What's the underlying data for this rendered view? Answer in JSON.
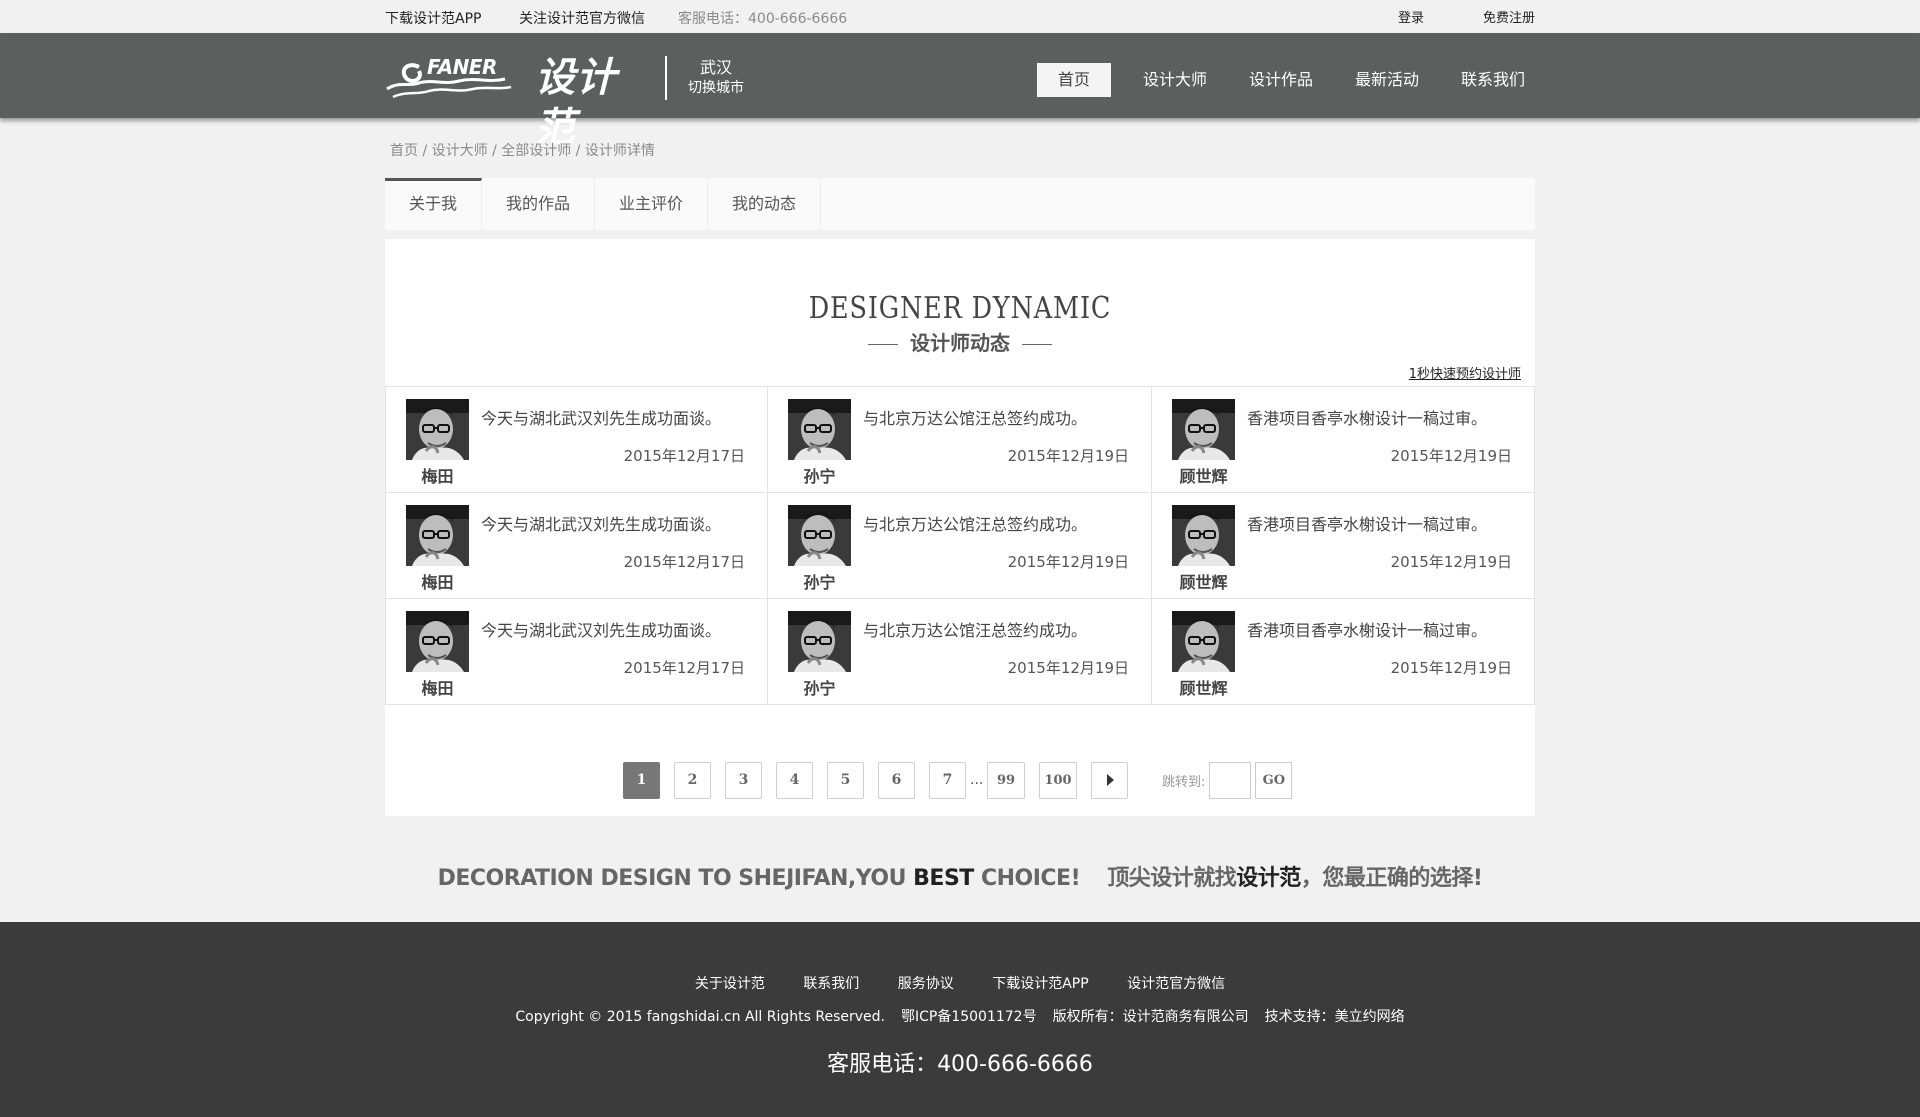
{
  "topbar": {
    "download_app": "下载设计范APP",
    "follow_wechat": "关注设计范官方微信",
    "service_phone": "客服电话：400-666-6666",
    "login": "登录",
    "register": "免费注册"
  },
  "header": {
    "logo_en": "FANER",
    "logo_cn": "设计范",
    "city": "武汉",
    "switch_city": "切换城市",
    "nav": [
      "首页",
      "设计大师",
      "设计作品",
      "最新活动",
      "联系我们"
    ],
    "active_nav": 0
  },
  "breadcrumb": "首页 / 设计大师 / 全部设计师 / 设计师详情",
  "tabs": [
    "关于我",
    "我的作品",
    "业主评价",
    "我的动态"
  ],
  "section": {
    "title_en": "DESIGNER DYNAMIC",
    "title_cn": "设计师动态",
    "book_link": "1秒快速预约设计师"
  },
  "dynamics": [
    [
      {
        "name": "梅田",
        "text": "今天与湖北武汉刘先生成功面谈。",
        "date": "2015年12月17日"
      },
      {
        "name": "孙宁",
        "text": "与北京万达公馆汪总签约成功。",
        "date": "2015年12月19日"
      },
      {
        "name": "顾世辉",
        "text": "香港项目香亭水榭设计一稿过审。",
        "date": "2015年12月19日"
      }
    ],
    [
      {
        "name": "梅田",
        "text": "今天与湖北武汉刘先生成功面谈。",
        "date": "2015年12月17日"
      },
      {
        "name": "孙宁",
        "text": "与北京万达公馆汪总签约成功。",
        "date": "2015年12月19日"
      },
      {
        "name": "顾世辉",
        "text": "香港项目香亭水榭设计一稿过审。",
        "date": "2015年12月19日"
      }
    ],
    [
      {
        "name": "梅田",
        "text": "今天与湖北武汉刘先生成功面谈。",
        "date": "2015年12月17日"
      },
      {
        "name": "孙宁",
        "text": "与北京万达公馆汪总签约成功。",
        "date": "2015年12月19日"
      },
      {
        "name": "顾世辉",
        "text": "香港项目香亭水榭设计一稿过审。",
        "date": "2015年12月19日"
      }
    ]
  ],
  "pagination": {
    "pages": [
      "1",
      "2",
      "3",
      "4",
      "5",
      "6",
      "7"
    ],
    "ellipsis": "...",
    "tail_pages": [
      "99",
      "100"
    ],
    "current": "1",
    "jump_label": "跳转到:",
    "go": "GO",
    "next_icon": "caret-right-icon"
  },
  "slogan": {
    "en_part1": "DECORATION DESIGN TO SHEJIFAN,YOU ",
    "en_bold": "BEST",
    "en_part2": " CHOICE!",
    "cn_part1": "顶尖设计就找",
    "cn_bold": "设计范",
    "cn_part2": "，您最正确的选择!"
  },
  "footer": {
    "links": [
      "关于设计范",
      "联系我们",
      "服务协议",
      "下载设计范APP",
      "设计范官方微信"
    ],
    "copyright": "Copyright © 2015 fangshidai.cn All Rights Reserved.",
    "icp": "鄂ICP备15001172号",
    "owner": "版权所有：设计范商务有限公司",
    "tech": "技术支持：美立约网络",
    "phone": "客服电话：400-666-6666"
  },
  "colors": {
    "header_bg": "#5d5f5f",
    "footer_bg": "#3b3b3b",
    "page_bg": "#f1f1f1",
    "active_page": "#777777"
  }
}
